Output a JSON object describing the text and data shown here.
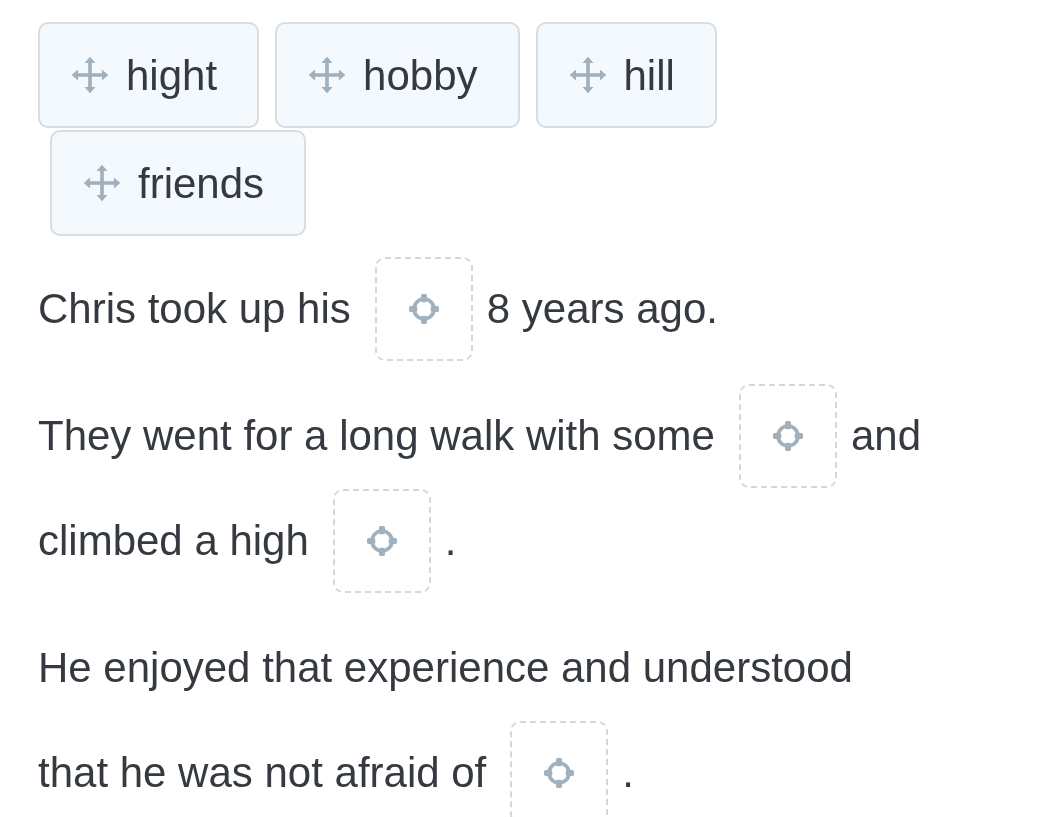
{
  "tile_rows": [
    [
      "hight",
      "hobby",
      "hill"
    ],
    [
      "friends"
    ]
  ],
  "sentences": [
    [
      [
        {
          "kind": "text",
          "text": "Chris took up his"
        },
        {
          "kind": "gap"
        },
        {
          "kind": "text",
          "text": "8 years ago."
        }
      ]
    ],
    [
      [
        {
          "kind": "text",
          "text": "They went for a long walk with some"
        },
        {
          "kind": "gap"
        },
        {
          "kind": "text",
          "text": "and"
        }
      ],
      [
        {
          "kind": "text",
          "text": "climbed a high"
        },
        {
          "kind": "gap"
        },
        {
          "kind": "text",
          "text": "."
        }
      ]
    ],
    [
      [
        {
          "kind": "text",
          "text": "He enjoyed that experience and understood"
        }
      ],
      [
        {
          "kind": "text",
          "text": "that he was not afraid of"
        },
        {
          "kind": "gap"
        },
        {
          "kind": "text",
          "text": "."
        }
      ]
    ]
  ]
}
